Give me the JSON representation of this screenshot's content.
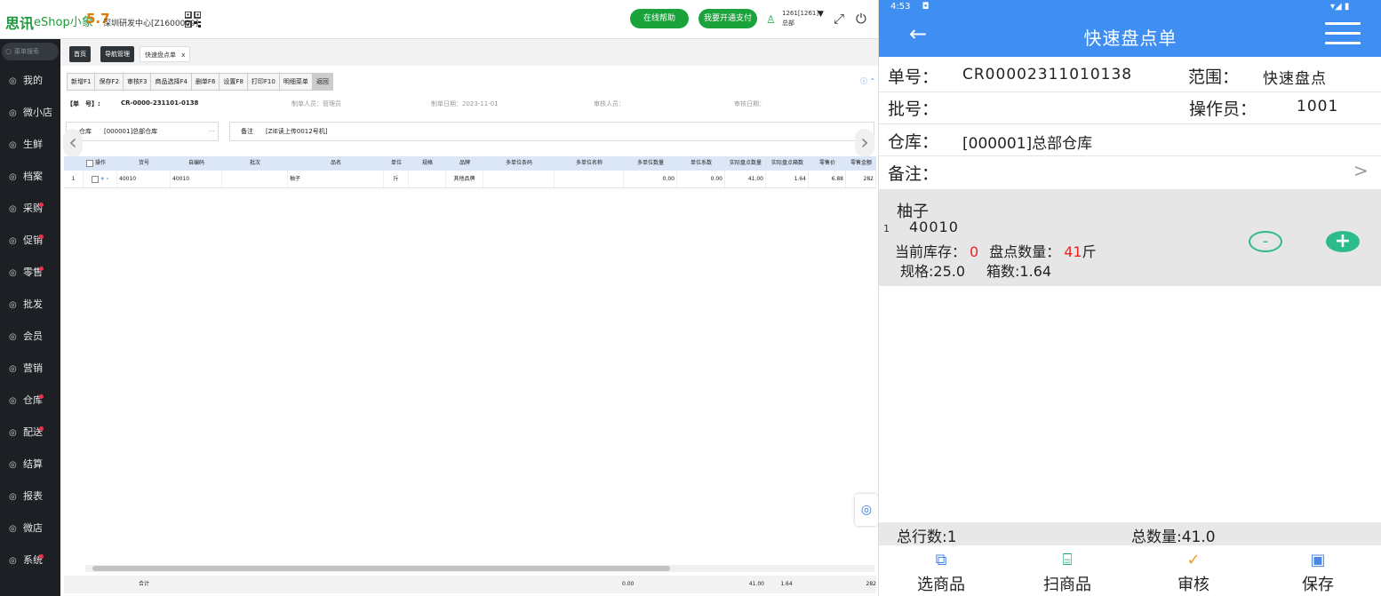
{
  "desktop": {
    "logo_cn": "思讯",
    "logo_en": "eShop小象",
    "logo_ver": "5.7",
    "org": "深圳研发中心[Z1600009]",
    "help_btn": "在线帮助",
    "pay_btn": "我要开通支付",
    "user_id": "1261[1261]",
    "user_dept": "总部",
    "sidebar": {
      "search_placeholder": "菜单搜索",
      "items": [
        {
          "label": "我的",
          "icon": "person-icon",
          "dot": false
        },
        {
          "label": "微小店",
          "icon": "shop-icon",
          "dot": false
        },
        {
          "label": "生鲜",
          "icon": "apple-icon",
          "dot": false
        },
        {
          "label": "档案",
          "icon": "document-icon",
          "dot": false
        },
        {
          "label": "采购",
          "icon": "cart-icon",
          "dot": true
        },
        {
          "label": "促销",
          "icon": "promo-icon",
          "dot": true
        },
        {
          "label": "零售",
          "icon": "retail-icon",
          "dot": true
        },
        {
          "label": "批发",
          "icon": "wholesale-icon",
          "dot": false
        },
        {
          "label": "会员",
          "icon": "member-icon",
          "dot": false
        },
        {
          "label": "营销",
          "icon": "marketing-icon",
          "dot": false
        },
        {
          "label": "仓库",
          "icon": "warehouse-icon",
          "dot": true
        },
        {
          "label": "配送",
          "icon": "truck-icon",
          "dot": true
        },
        {
          "label": "结算",
          "icon": "settle-icon",
          "dot": false
        },
        {
          "label": "报表",
          "icon": "report-icon",
          "dot": false
        },
        {
          "label": "微店",
          "icon": "store-icon",
          "dot": false
        },
        {
          "label": "系统",
          "icon": "system-icon",
          "dot": true
        }
      ]
    },
    "tabs": [
      "首页",
      "导航管理",
      "快速盘点单"
    ],
    "tab_close": "x",
    "toolbar": [
      "新增F1",
      "保存F2",
      "审核F3",
      "商品选择F4",
      "删单F6",
      "设置F8",
      "打印F10",
      "明细菜单",
      "返回"
    ],
    "header": {
      "no_label": "【单　号】:",
      "no_value": "CR-0000-231101-0138",
      "maker": "制单人员：管理员",
      "date": "制单日期：2023-11-01",
      "auditor": "审核人员：",
      "audit_date": "审核日期："
    },
    "form": {
      "warehouse_label": "仓库",
      "warehouse_value": "[000001]总部仓库",
      "warehouse_more": "···",
      "remark_label": "备注",
      "remark_value": "[ZiE读上传0012号机]"
    },
    "grid": {
      "columns": [
        "",
        "操作",
        "货号",
        "自编码",
        "批次",
        "品名",
        "单位",
        "规格",
        "品牌",
        "多单位条码",
        "多单位名称",
        "多单位数量",
        "单位系数",
        "实际盘点数量",
        "实际盘点箱数",
        "零售价",
        "零售金额"
      ],
      "rows": [
        [
          "1",
          "",
          "40010",
          "40010",
          "",
          "柚子",
          "斤",
          "",
          "其他品牌",
          "",
          "",
          "0.00",
          "0.00",
          "41.00",
          "1.64",
          "6.88",
          "282"
        ]
      ],
      "footer_label": "合计",
      "footer": {
        "multi_qty": "0.00",
        "actual_qty": "41.00",
        "actual_box": "1.64",
        "amount": "282"
      }
    }
  },
  "phone": {
    "status_time": "4:53",
    "title": "快速盘点单",
    "doc_no_label": "单号：",
    "doc_no": "CR00002311010138",
    "scope_label": "范围：",
    "scope": "快速盘点",
    "batch_label": "批号：",
    "operator_label": "操作员：",
    "operator": "1001",
    "warehouse_label": "仓库：",
    "warehouse": "[000001]总部仓库",
    "remark_label": "备注：",
    "item": {
      "index": "1",
      "name": "柚子",
      "code": "40010",
      "stock_label": "当前库存：",
      "stock": "0",
      "count_label": "盘点数量：",
      "count": "41",
      "unit": "斤",
      "spec": "规格:25.0",
      "boxes": "箱数:1.64"
    },
    "total_rows": "总行数:1",
    "total_qty": "总数量:41.0",
    "nav": [
      {
        "label": "选商品",
        "icon": "boxes-icon",
        "color": "#4a86e8"
      },
      {
        "label": "扫商品",
        "icon": "scan-icon",
        "color": "#1aa37a"
      },
      {
        "label": "审核",
        "icon": "check-circle-icon",
        "color": "#f0a020"
      },
      {
        "label": "保存",
        "icon": "save-icon",
        "color": "#4a86e8"
      }
    ]
  }
}
